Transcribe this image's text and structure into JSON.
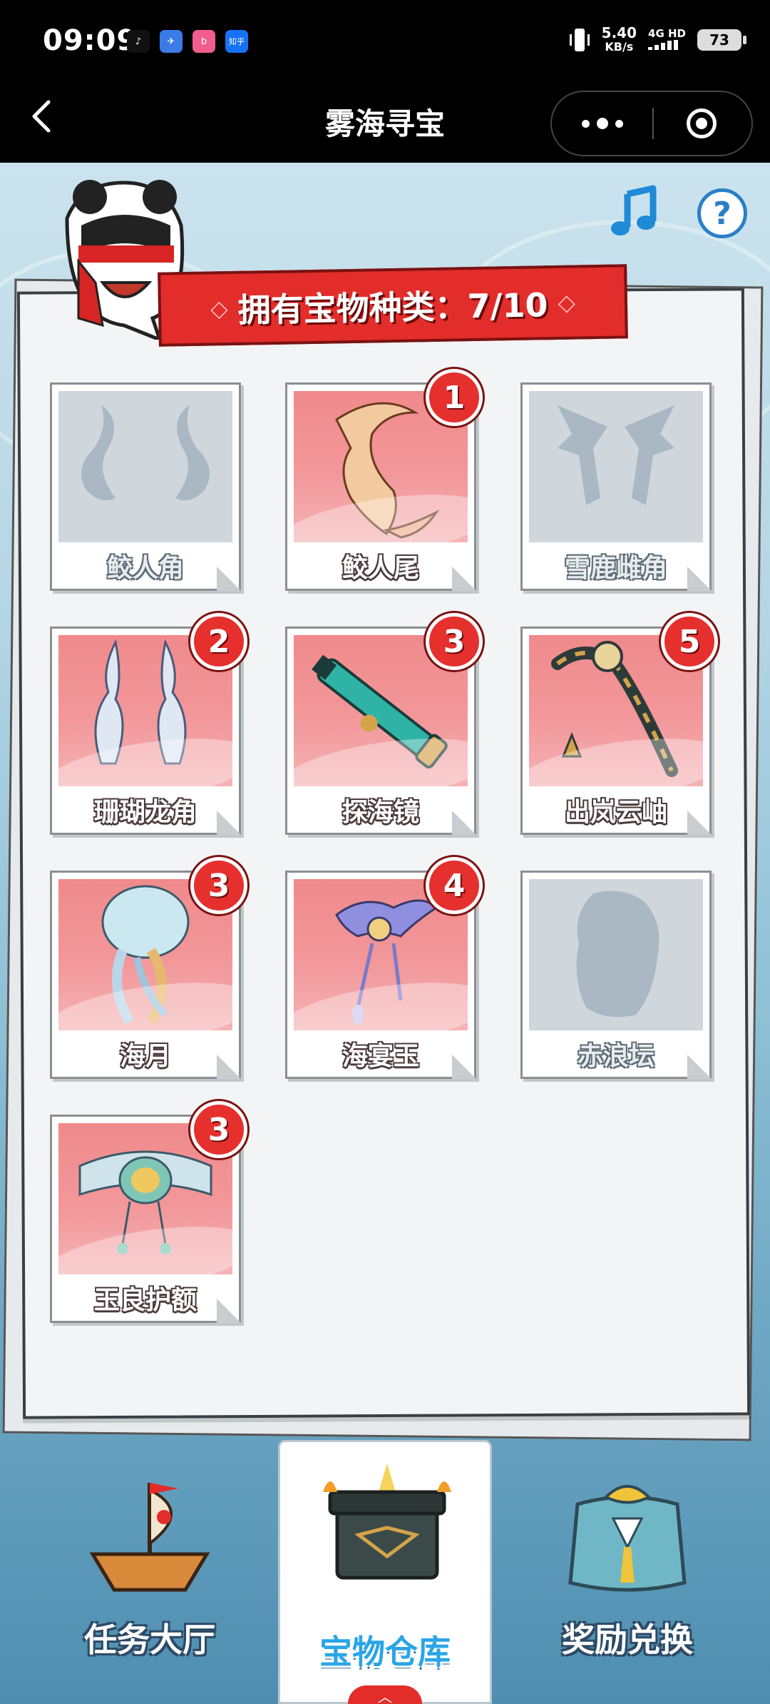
{
  "status_bar": {
    "time": "09:09",
    "apps": [
      {
        "icon": "tiktok-icon",
        "glyph": "♪",
        "color": "#111111"
      },
      {
        "icon": "feishu-icon",
        "glyph": "✈",
        "color": "#3b7be6"
      },
      {
        "icon": "bilibili-icon",
        "glyph": "b",
        "color": "#f25d8e"
      },
      {
        "icon": "zhihu-icon",
        "glyph": "知乎",
        "color": "#1772f6"
      }
    ],
    "speed_value": "5.40",
    "speed_unit": "KB/s",
    "network": "4G HD",
    "battery": "73"
  },
  "nav": {
    "title": "雾海寻宝"
  },
  "header": {
    "banner_text": "拥有宝物种类：7/10"
  },
  "treasures": [
    {
      "name": "鲛人角",
      "owned": false,
      "count": ""
    },
    {
      "name": "鲛人尾",
      "owned": true,
      "count": "1"
    },
    {
      "name": "雪鹿雌角",
      "owned": false,
      "count": ""
    },
    {
      "name": "珊瑚龙角",
      "owned": true,
      "count": "2"
    },
    {
      "name": "探海镜",
      "owned": true,
      "count": "3"
    },
    {
      "name": "出岚云岫",
      "owned": true,
      "count": "5"
    },
    {
      "name": "海月",
      "owned": true,
      "count": "3"
    },
    {
      "name": "海宴玉",
      "owned": true,
      "count": "4"
    },
    {
      "name": "赤浪坛",
      "owned": false,
      "count": ""
    },
    {
      "name": "玉良护额",
      "owned": true,
      "count": "3"
    }
  ],
  "bottom_tabs": [
    {
      "label": "任务大厅",
      "active": false
    },
    {
      "label": "宝物仓库",
      "active": true
    },
    {
      "label": "奖励兑换",
      "active": false
    }
  ],
  "colors": {
    "accent_red": "#e22d2b",
    "tab_active_blue": "#2aa5e6",
    "help_blue": "#2b7fc7"
  }
}
